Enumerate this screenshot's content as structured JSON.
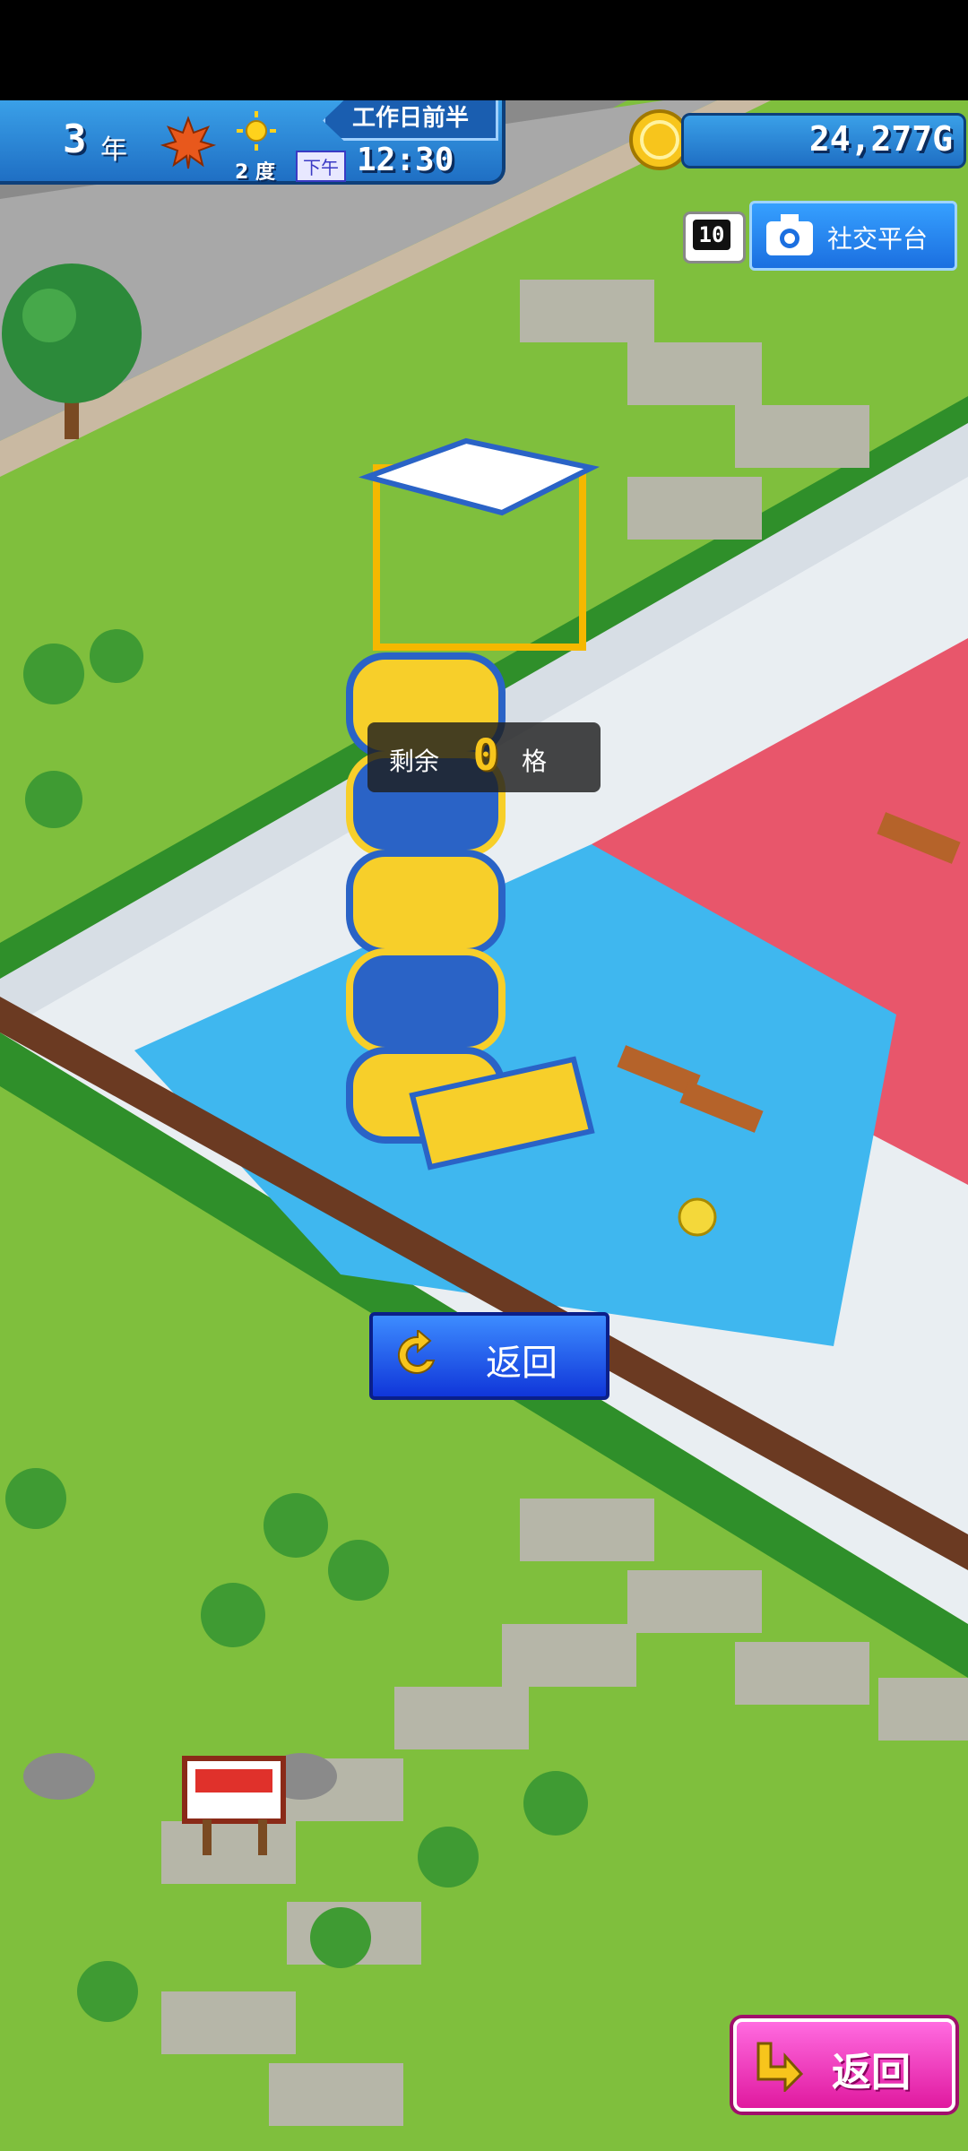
{
  "hud": {
    "year_number": "3",
    "year_suffix": "年",
    "season_icon": "maple-leaf-icon",
    "weather_icon": "sun-icon",
    "temperature": "2 度",
    "period": "下午",
    "time": "12:30",
    "day_part": "工作日前半",
    "money": "24,277G",
    "coin_icon": "gold-coin-icon"
  },
  "social": {
    "count_badge": "10",
    "label": "社交平台",
    "icon": "camera-icon"
  },
  "placement": {
    "remaining_prefix": "剩余",
    "remaining_value": "0",
    "remaining_suffix": "格"
  },
  "buttons": {
    "center_return": "返回",
    "corner_return": "返回"
  },
  "colors": {
    "hud_blue": "#1f6fc4",
    "grass": "#7fbf3d",
    "pool": "#3fb7ef",
    "deck_red": "#e8566b",
    "return_blue": "#1036d9",
    "return_pink": "#e0199f",
    "coin_gold": "#f7c51c"
  }
}
